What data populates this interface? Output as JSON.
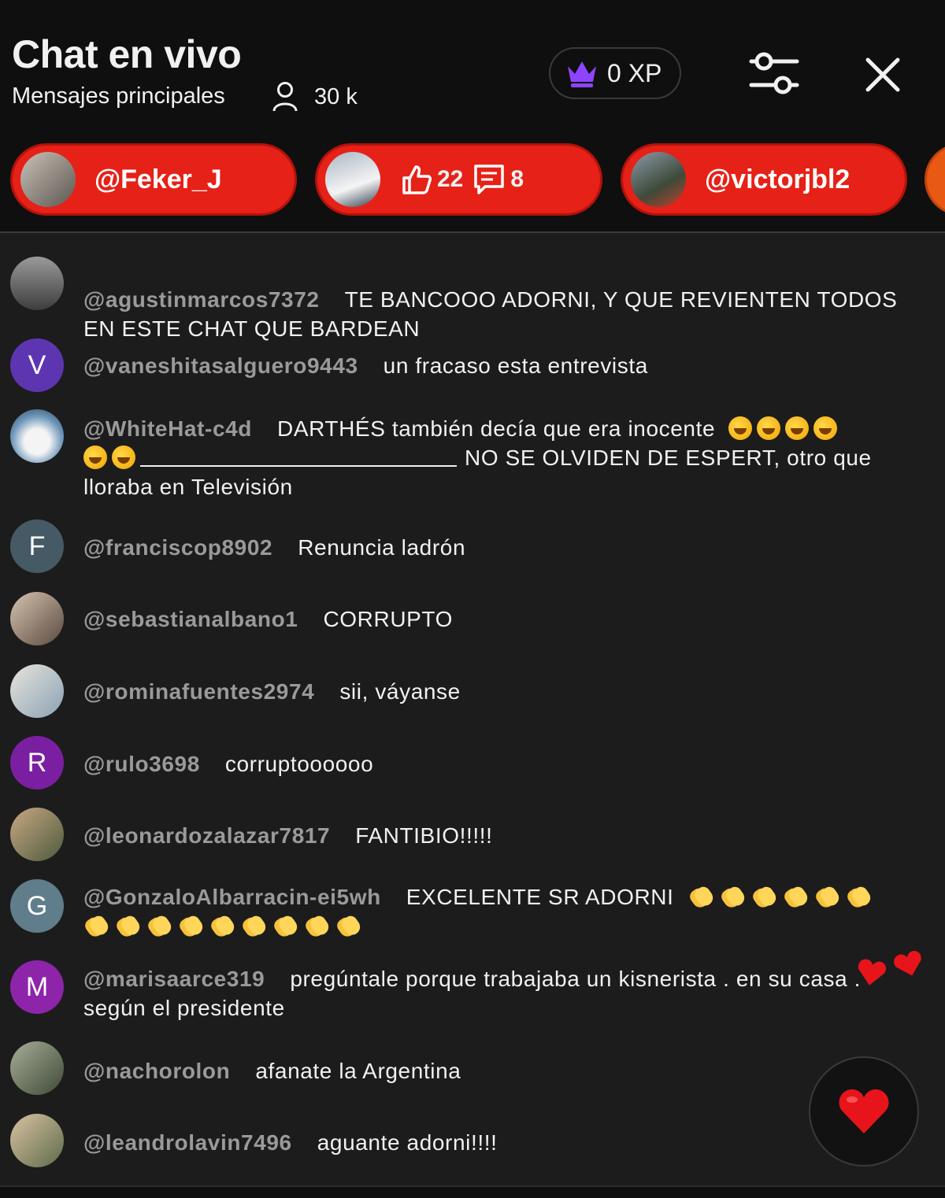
{
  "header": {
    "title": "Chat en vivo",
    "subtitle": "Mensajes principales",
    "viewers": "30 k",
    "xp": "0 XP"
  },
  "pinned": [
    {
      "type": "user",
      "label": "@Feker_J"
    },
    {
      "type": "stats",
      "likes": "22",
      "comments": "8"
    },
    {
      "type": "user",
      "label": "@victorjbl2"
    }
  ],
  "messages": [
    {
      "author": "@agustinmarcos7372",
      "text": "TE BANCOOO ADORNI, Y QUE REVIENTEN TODOS EN ESTE CHAT QUE BARDEAN",
      "avatar_color": "#6d6d6d",
      "initial": ""
    },
    {
      "author": "@vaneshitasalguero9443",
      "text": "un fracaso esta entrevista",
      "avatar_color": "#5e35b1",
      "initial": "V"
    },
    {
      "author": "@WhiteHat-c4d",
      "text": "DARTHÉS también decía que era inocente",
      "text2": "NO SE OLVIDEN DE ESPERT, otro que lloraba en Televisión",
      "avatar_color": "#7fa9c8",
      "initial": ""
    },
    {
      "author": "@franciscop8902",
      "text": "Renuncia ladrón",
      "avatar_color": "#455a64",
      "initial": "F"
    },
    {
      "author": "@sebastianalbano1",
      "text": "CORRUPTO",
      "avatar_color": "#8a7566",
      "initial": ""
    },
    {
      "author": "@rominafuentes2974",
      "text": "sii, váyanse",
      "avatar_color": "#a9b8c2",
      "initial": ""
    },
    {
      "author": "@rulo3698",
      "text": "corruptoooooo",
      "avatar_color": "#7b1fa2",
      "initial": "R"
    },
    {
      "author": "@leonardozalazar7817",
      "text": "FANTIBIO!!!!!",
      "avatar_color": "#9a7b62",
      "initial": ""
    },
    {
      "author": "@GonzaloAlbarracin-ei5wh",
      "text": "EXCELENTE SR ADORNI",
      "avatar_color": "#607d8b",
      "initial": "G"
    },
    {
      "author": "@marisaarce319",
      "text": "pregúntale porque trabajaba un kisnerista . en su casa . según el presidente",
      "avatar_color": "#8e24aa",
      "initial": "M"
    },
    {
      "author": "@nachorolon",
      "text": "afanate la Argentina",
      "avatar_color": "#6f7561",
      "initial": ""
    },
    {
      "author": "@leandrolavin7496",
      "text": "aguante adorni!!!!",
      "avatar_color": "#8c7a64",
      "initial": ""
    }
  ],
  "colors": {
    "accent": "#e62117",
    "background": "#0f0f0f",
    "chat_bg": "#1c1c1c",
    "crown": "#8e44ff",
    "heart": "#e8141b"
  }
}
